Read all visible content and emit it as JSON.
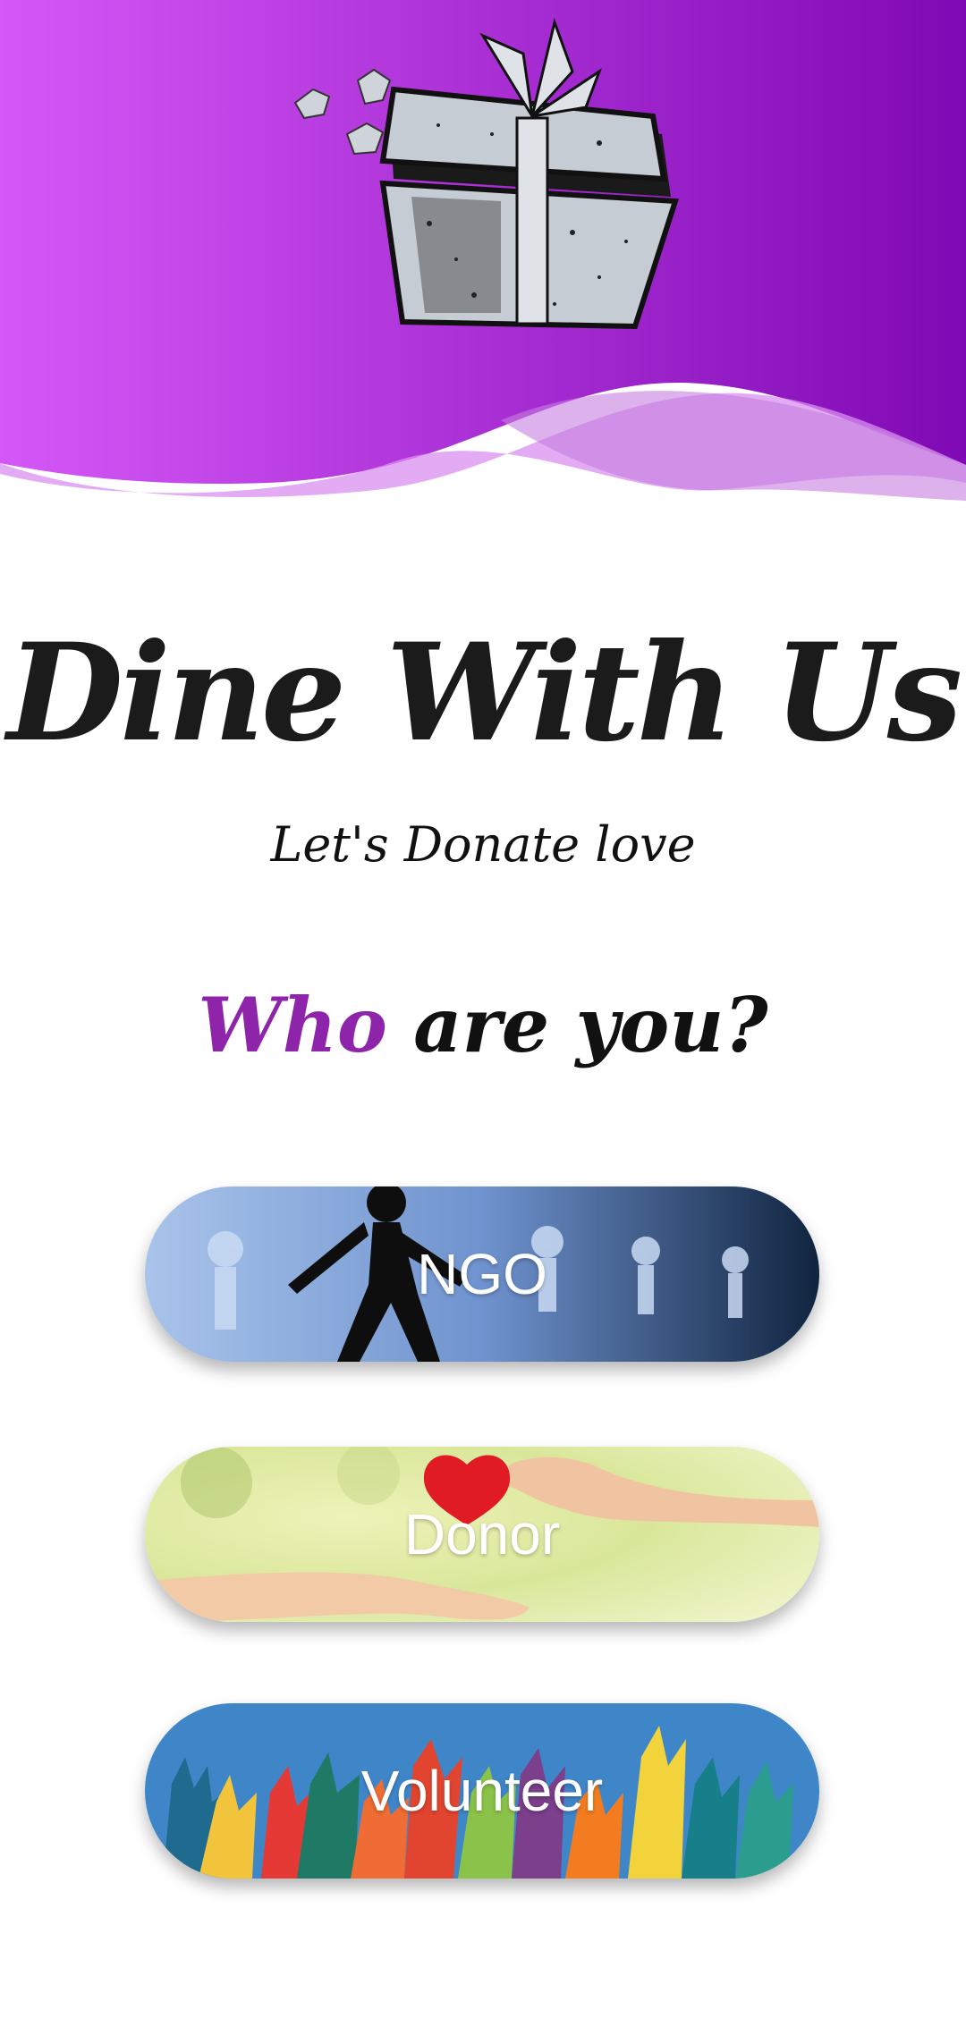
{
  "app": {
    "title": "Dine With Us",
    "tagline": "Let's Donate love"
  },
  "question": {
    "accent_word": "Who",
    "rest": " are you?"
  },
  "roles": [
    {
      "label": "NGO"
    },
    {
      "label": "Donor"
    },
    {
      "label": "Volunteer"
    }
  ],
  "icons": {
    "header": "gift-box-icon"
  },
  "colors": {
    "header_gradient_start": "#d557f7",
    "header_gradient_end": "#7f09b4",
    "accent": "#8e24aa",
    "title": "#1b1b1b"
  }
}
